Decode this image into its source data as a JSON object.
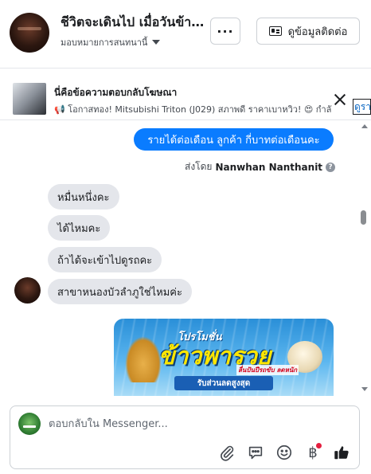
{
  "header": {
    "title": "ชีวิตจะเดินไป เมื่อวันข้างห...",
    "assignee_label": "มอบหมายการสนทนานี้",
    "more_label": "···",
    "contact_button_label": "ดูข้อมูลติดต่อ"
  },
  "ad_reply": {
    "title": "นี่คือข้อความตอบกลับโฆษณา",
    "text": "📢 โอกาสทอง! Mitsubishi Triton (J029) สภาพดี ราคาเบาหวิว! 😍 กำลั",
    "view_link": "ดูรา"
  },
  "messages": {
    "outgoing_text": "รายได้ต่อเดือน  ลูกค้า  กี่บาทต่อเดือนคะ",
    "sent_by_prefix": "ส่งโดย",
    "sent_by_name": "Nanwhan Nanthanit",
    "help_glyph": "?",
    "incoming": [
      "หมื่นหนึ่งคะ",
      "ได้ไหมคะ",
      "ถ้าได้จะเข้าไปดูรถคะ",
      "สาขาหนองบัวลำภูใช่ไหมค่ะ"
    ]
  },
  "promo": {
    "subtitle": "โปรโมชั่น",
    "headline": "ข้าวพารวย",
    "tag": "ลื่นปันปีรถขับ ลดหนัก",
    "band": "รับส่วนลดสูงสุด"
  },
  "composer": {
    "placeholder": "ตอบกลับใน Messenger...",
    "baht_symbol": "฿"
  },
  "icons": {
    "attach": "paperclip-icon",
    "saved_replies": "chat-bubble-icon",
    "emoji": "smiley-icon",
    "payment": "baht-icon",
    "like": "thumbs-up-icon"
  },
  "colors": {
    "outgoing_bubble": "#0a7cff",
    "incoming_bubble": "#e4e6eb",
    "like_icon": "#1c1e21",
    "notification_dot": "#e41e3f"
  }
}
